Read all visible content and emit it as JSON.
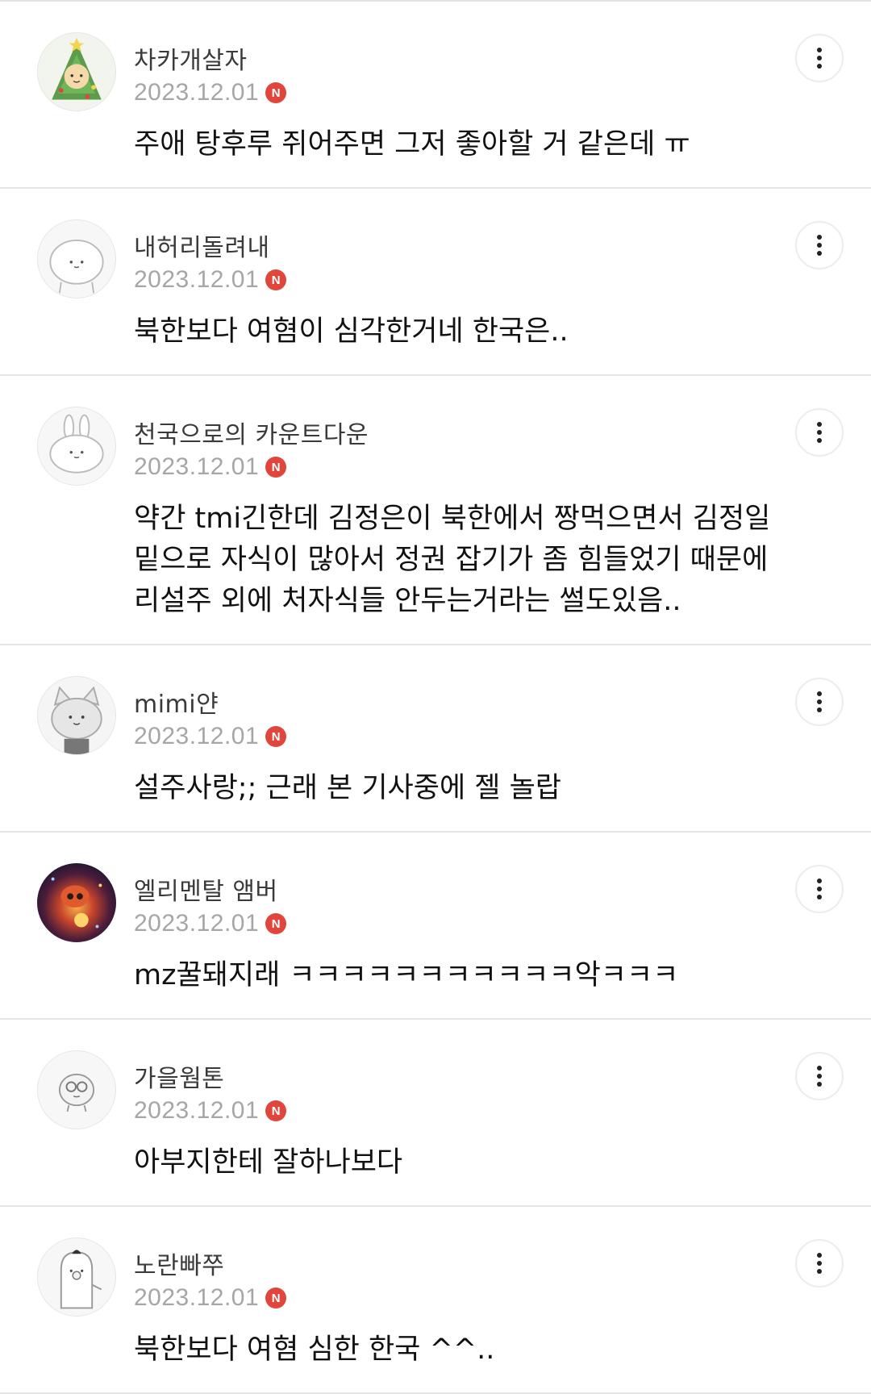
{
  "comments": [
    {
      "nickname": "차카개살자",
      "date": "2023.12.01",
      "badge": "N",
      "text": "주애 탕후루 쥐어주면 그저 좋아할 거 같은데 ㅠ",
      "avatar": "christmas-tree-character"
    },
    {
      "nickname": "내허리돌려내",
      "date": "2023.12.01",
      "badge": "N",
      "text": "북한보다 여혐이 심각한거네 한국은..",
      "avatar": "default-blob-character"
    },
    {
      "nickname": "천국으로의 카운트다운",
      "date": "2023.12.01",
      "badge": "N",
      "text": "약간 tmi긴한데 김정은이 북한에서 짱먹으면서 김정일\n밑으로 자식이 많아서 정권 잡기가 좀 힘들었기 때문에\n리설주 외에 처자식들 안두는거라는 썰도있음..",
      "avatar": "default-rabbit-character"
    },
    {
      "nickname": "mimi얀",
      "date": "2023.12.01",
      "badge": "N",
      "text": "설주사랑;; 근래 본 기사중에 젤 놀랍",
      "avatar": "default-cat-character"
    },
    {
      "nickname": "엘리멘탈 앰버",
      "date": "2023.12.01",
      "badge": "N",
      "text": "mz꿀돼지래 ㅋㅋㅋㅋㅋㅋㅋㅋㅋㅋㅋ악ㅋㅋㅋ",
      "avatar": "photo-avatar"
    },
    {
      "nickname": "가을웜톤",
      "date": "2023.12.01",
      "badge": "N",
      "text": "아부지한테 잘하나보다",
      "avatar": "default-glasses-character"
    },
    {
      "nickname": "노란빠쭈",
      "date": "2023.12.01",
      "badge": "N",
      "text": "북한보다 여혐 심한 한국 ^^..",
      "avatar": "default-ghost-character"
    }
  ],
  "colors": {
    "badge": "#e0463c",
    "date": "#a6a6a6",
    "divider": "#e6e6e6"
  }
}
